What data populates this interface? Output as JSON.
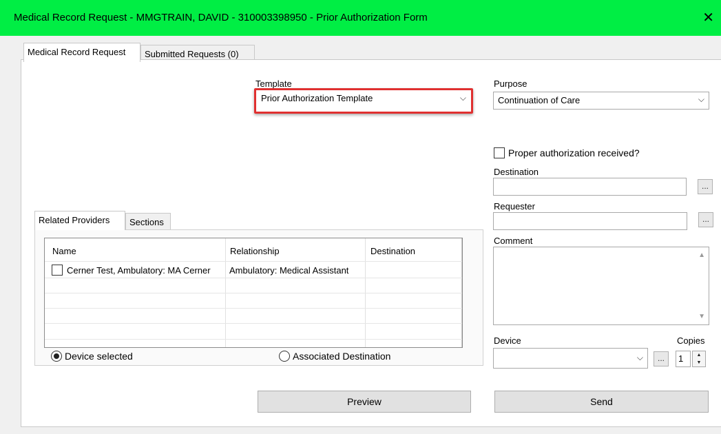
{
  "window": {
    "title": "Medical Record Request - MMGTRAIN, DAVID - 310003398950 - Prior Authorization Form",
    "close_glyph": "✕"
  },
  "tabs": [
    {
      "label": "Medical Record Request",
      "active": true
    },
    {
      "label": "Submitted Requests (0)",
      "active": false
    }
  ],
  "template": {
    "label": "Template",
    "value": "Prior Authorization Template"
  },
  "purpose": {
    "label": "Purpose",
    "value": "Continuation of Care"
  },
  "authorization": {
    "label": "Proper authorization received?",
    "checked": false
  },
  "destination": {
    "label": "Destination",
    "value": "",
    "browse": "..."
  },
  "requester": {
    "label": "Requester",
    "value": "",
    "browse": "..."
  },
  "comment": {
    "label": "Comment",
    "value": ""
  },
  "device": {
    "label": "Device",
    "value": "",
    "browse": "..."
  },
  "copies": {
    "label": "Copies",
    "value": "1"
  },
  "subtabs": [
    {
      "label": "Related Providers",
      "active": true
    },
    {
      "label": "Sections",
      "active": false
    }
  ],
  "providers_table": {
    "columns": [
      "Name",
      "Relationship",
      "Destination"
    ],
    "rows": [
      {
        "name": "Cerner Test, Ambulatory: MA Cerner",
        "relationship": "Ambulatory: Medical Assistant",
        "destination": "",
        "checked": false
      }
    ]
  },
  "radios": [
    {
      "label": "Device selected",
      "selected": true
    },
    {
      "label": "Associated Destination",
      "selected": false
    }
  ],
  "buttons": {
    "preview": "Preview",
    "send": "Send"
  },
  "icons": {
    "dropdown": "chevron-down-icon",
    "close": "close-icon",
    "scroll_up": "▲",
    "scroll_down": "▼",
    "chevron": "⌵"
  },
  "colors": {
    "titlebar": "#00ee44",
    "highlight": "#e03030"
  }
}
